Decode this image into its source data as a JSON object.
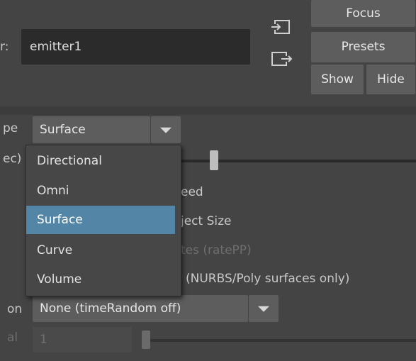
{
  "header": {
    "name_label_partial": "r:",
    "name_value": "emitter1",
    "buttons": {
      "focus": "Focus",
      "presets": "Presets",
      "show": "Show",
      "hide": "Hide"
    }
  },
  "rows": {
    "type_label_partial": "pe",
    "type_value": "Surface",
    "rate_label_partial": "ec)",
    "speed_label_partial": "eed",
    "object_size_label_partial": "ject Size",
    "rate_pp_label_partial": "tes (ratePP)",
    "nurbs_label_partial": "(NURBS/Poly surfaces only)",
    "random_label_partial": "on",
    "random_value": "None (timeRandom off)",
    "interval_label_partial": "al",
    "interval_value": "1"
  },
  "dropdown": {
    "options": [
      "Directional",
      "Omni",
      "Surface",
      "Curve",
      "Volume"
    ],
    "selected": "Surface"
  },
  "icons": [
    "input-connection-icon",
    "output-connection-icon",
    "chevron-down-icon"
  ]
}
